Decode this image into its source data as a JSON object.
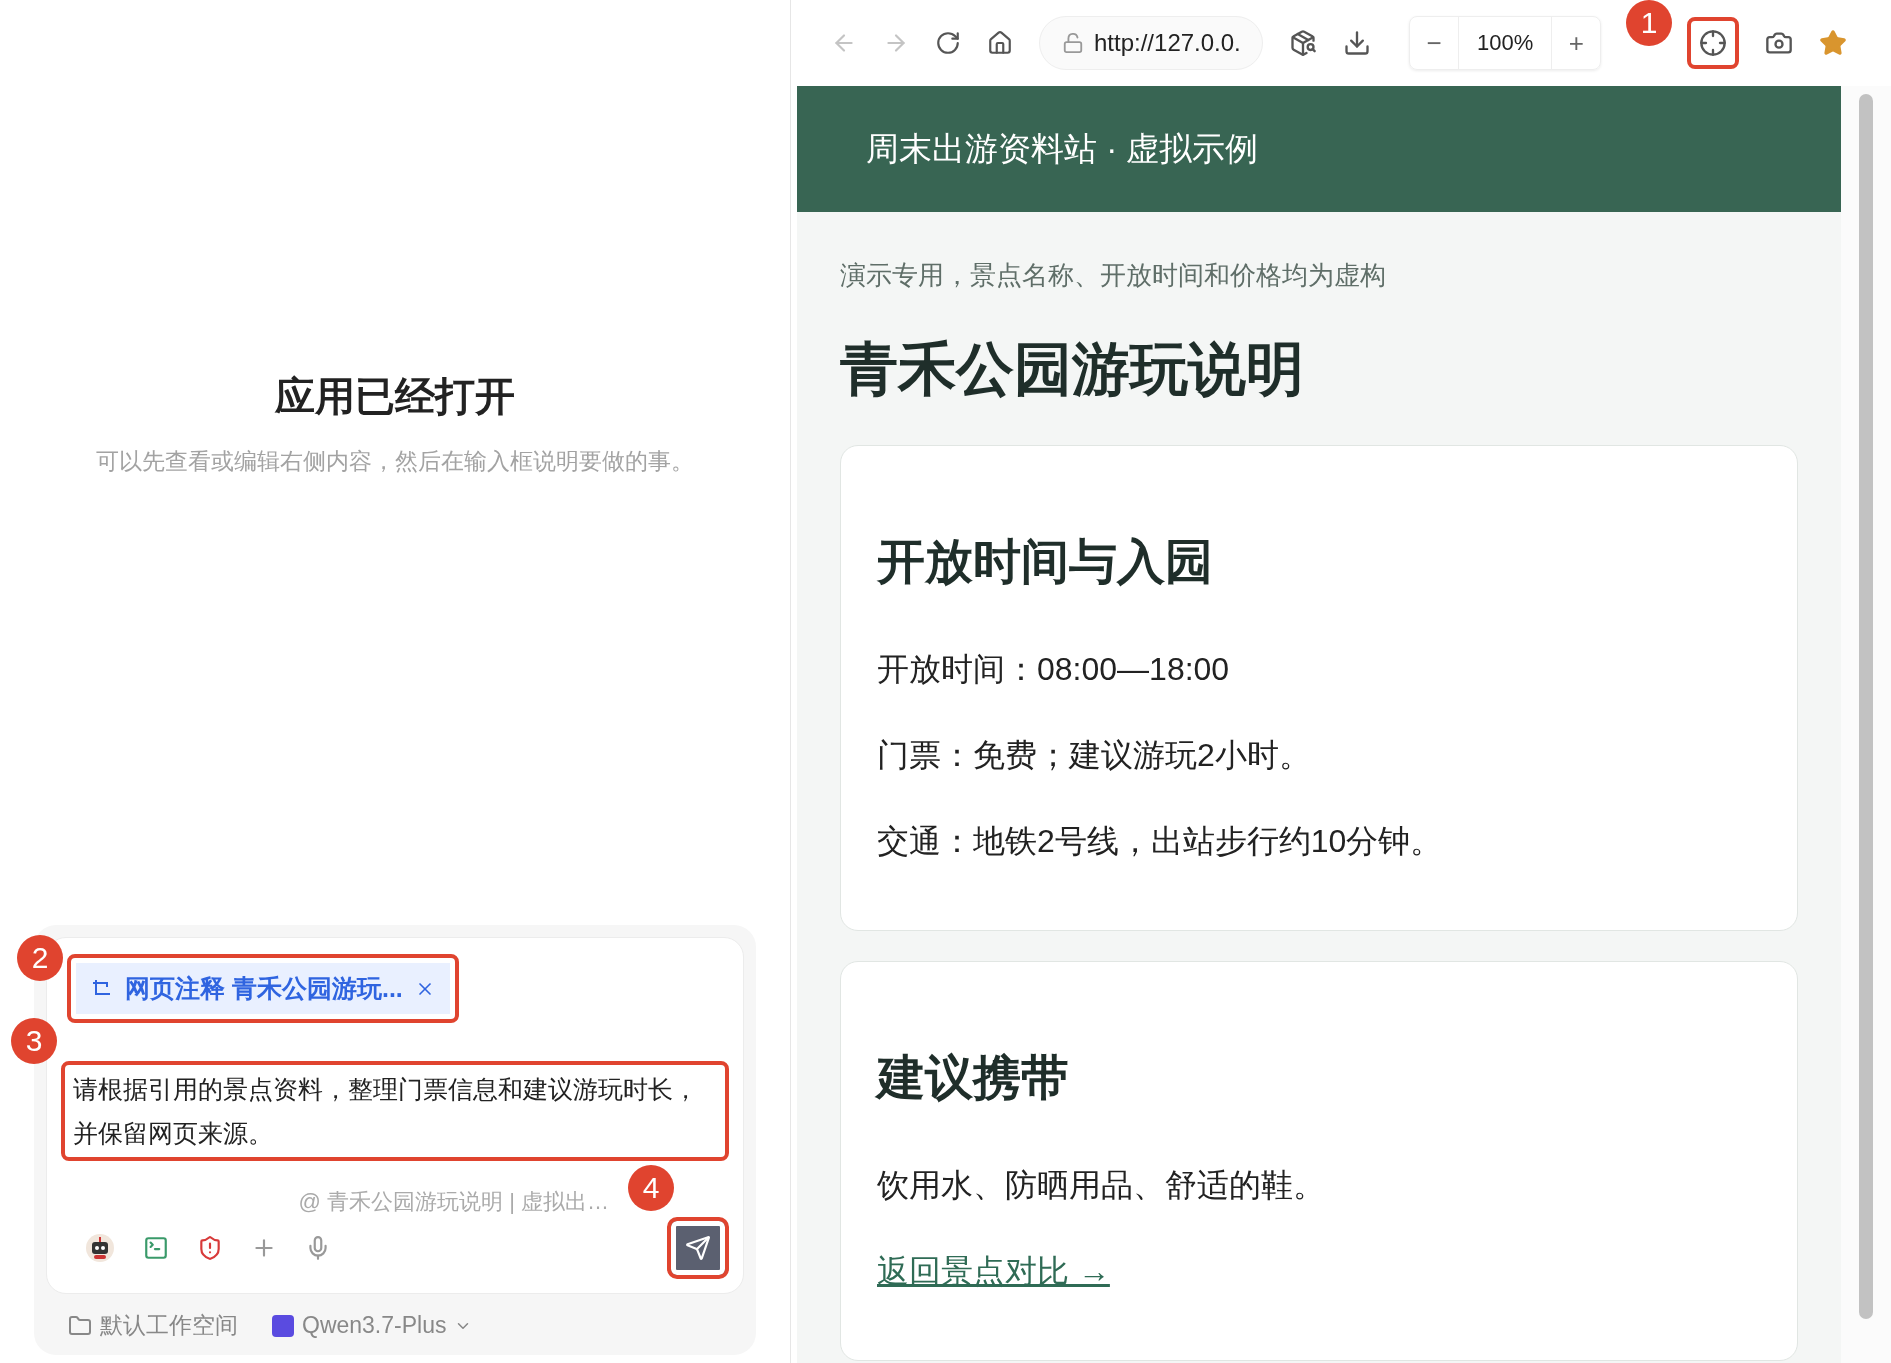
{
  "left_pane": {
    "title": "应用已经打开",
    "subtitle": "可以先查看或编辑右侧内容，然后在输入框说明要做的事。"
  },
  "composer": {
    "chip": {
      "label": "网页注释 青禾公园游玩...",
      "highlighted": true
    },
    "message": {
      "value": "请根据引用的景点资料，整理门票信息和建议游玩时长，并保留网页来源。",
      "highlighted": true
    },
    "context": "@ 青禾公园游玩说明 | 虚拟出…",
    "send_button": {
      "highlighted": true
    },
    "workspace": "默认工作空间",
    "model": "Qwen3.7-Plus"
  },
  "browser": {
    "back": {
      "disabled": true
    },
    "forward": {
      "disabled": true
    },
    "url": "http://127.0.0.",
    "zoom_out": "−",
    "zoom": "100%",
    "zoom_in": "+",
    "pick_element": {
      "highlighted": true
    },
    "bookmarked": true
  },
  "page": {
    "site_title": "周末出游资料站 · 虚拟示例",
    "note": "演示专用，景点名称、开放时间和价格均为虚构",
    "heading": "青禾公园游玩说明",
    "cards": [
      {
        "title": "开放时间与入园",
        "lines": [
          "开放时间：08:00—18:00",
          "门票：免费；建议游玩2小时。",
          "交通：地铁2号线，出站步行约10分钟。"
        ]
      },
      {
        "title": "建议携带",
        "lines": [
          "饮用水、防晒用品、舒适的鞋。"
        ],
        "link": "返回景点对比 →"
      }
    ]
  },
  "annotations": [
    {
      "label": "1"
    },
    {
      "label": "2"
    },
    {
      "label": "3"
    },
    {
      "label": "4"
    }
  ]
}
